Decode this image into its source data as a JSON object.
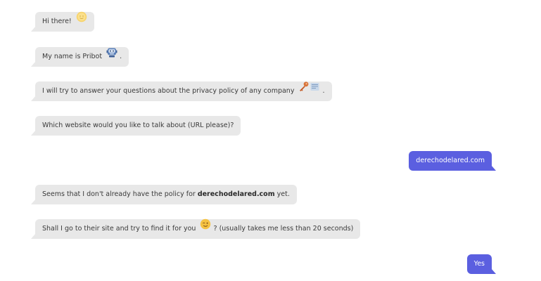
{
  "conversation": {
    "messages": [
      {
        "sender": "bot",
        "text": "Hi there!",
        "icon": "sun-face-emoji"
      },
      {
        "sender": "bot",
        "text": "My name is Pribot",
        "icon": "robot-emoji",
        "suffix": "."
      },
      {
        "sender": "bot",
        "text": "I will try to answer your questions about the privacy policy of any company",
        "icon": "key-document-emoji",
        "suffix": "."
      },
      {
        "sender": "bot",
        "text": "Which website would you like to talk about (URL please)?"
      },
      {
        "sender": "user",
        "text": "derechodelared.com"
      },
      {
        "sender": "bot",
        "text_before": "Seems that I don't already have the policy for",
        "text_bold": "derechodelared.com",
        "text_after": "yet."
      },
      {
        "sender": "bot",
        "text_before": "Shall I go to their site and try to find it for you",
        "icon": "winking-face-emoji",
        "text_after": "? (usually takes me less than 20 seconds)"
      },
      {
        "sender": "user",
        "text": "Yes"
      }
    ]
  },
  "colors": {
    "bot_bubble": "#e8e8e8",
    "user_bubble": "#5b5fe0",
    "user_text": "#ffffff",
    "bot_text": "#3a3a3a"
  }
}
